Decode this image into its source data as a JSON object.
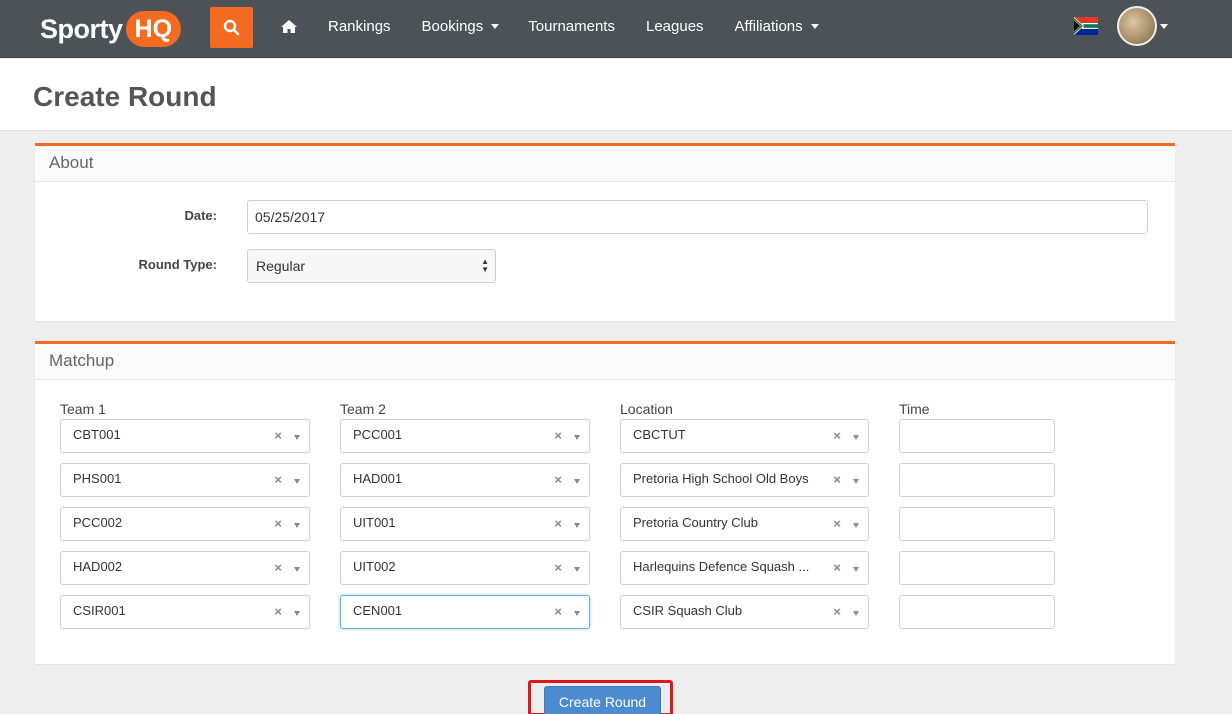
{
  "brand": {
    "part1": "Sporty",
    "part2": "HQ"
  },
  "nav": {
    "items": [
      {
        "label": "",
        "icon": "home-icon"
      },
      {
        "label": "Rankings"
      },
      {
        "label": "Bookings",
        "dropdown": true
      },
      {
        "label": "Tournaments"
      },
      {
        "label": "Leagues"
      },
      {
        "label": "Affiliations",
        "dropdown": true
      }
    ]
  },
  "page": {
    "title": "Create Round"
  },
  "about": {
    "heading": "About",
    "date_label": "Date:",
    "date_value": "05/25/2017",
    "round_type_label": "Round Type:",
    "round_type_value": "Regular"
  },
  "matchup": {
    "heading": "Matchup",
    "columns": [
      "Team 1",
      "Team 2",
      "Location",
      "Time"
    ],
    "rows": [
      {
        "team1": "CBT001",
        "team2": "PCC001",
        "location": "CBCTUT",
        "time": ""
      },
      {
        "team1": "PHS001",
        "team2": "HAD001",
        "location": "Pretoria High School Old Boys",
        "time": ""
      },
      {
        "team1": "PCC002",
        "team2": "UIT001",
        "location": "Pretoria Country Club",
        "time": ""
      },
      {
        "team1": "HAD002",
        "team2": "UIT002",
        "location": "Harlequins Defence Squash ...",
        "time": ""
      },
      {
        "team1": "CSIR001",
        "team2": "CEN001",
        "location": "CSIR Squash Club",
        "time": ""
      }
    ]
  },
  "actions": {
    "create_label": "Create Round"
  },
  "colors": {
    "accent": "#f26b21",
    "nav_bg": "#4d5256",
    "primary_button": "#4d8bd1"
  }
}
